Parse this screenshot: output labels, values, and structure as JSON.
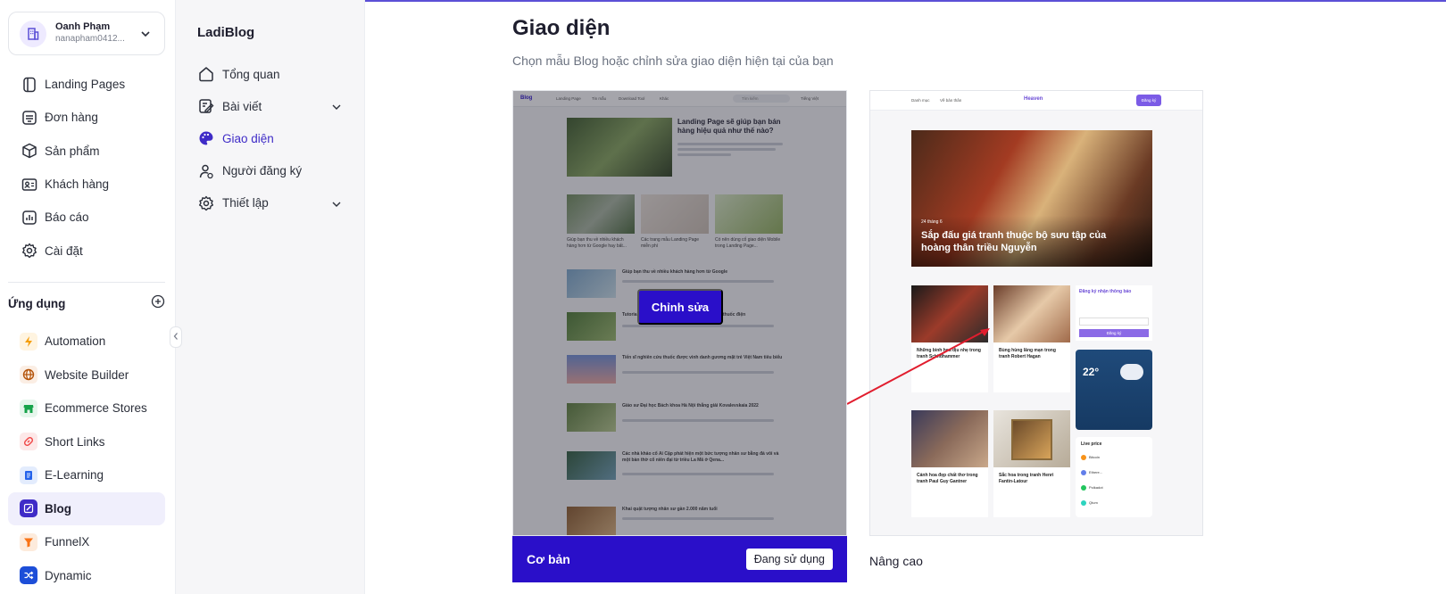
{
  "account": {
    "name": "Oanh Phạm",
    "email": "nanapham0412...",
    "avatar_icon": "building-icon"
  },
  "nav": {
    "items": [
      {
        "label": "Landing Pages",
        "icon": "pages-icon"
      },
      {
        "label": "Đơn hàng",
        "icon": "order-icon"
      },
      {
        "label": "Sản phẩm",
        "icon": "box-icon"
      },
      {
        "label": "Khách hàng",
        "icon": "contact-card-icon"
      },
      {
        "label": "Báo cáo",
        "icon": "report-icon"
      },
      {
        "label": "Cài đặt",
        "icon": "gear-icon"
      }
    ]
  },
  "apps": {
    "heading": "Ứng dụng",
    "items": [
      {
        "label": "Automation",
        "icon": "bolt-icon",
        "color": "#f59e0b"
      },
      {
        "label": "Website Builder",
        "icon": "globe-icon",
        "color": "#b45309"
      },
      {
        "label": "Ecommerce Stores",
        "icon": "store-icon",
        "color": "#16a34a"
      },
      {
        "label": "Short Links",
        "icon": "link-icon",
        "color": "#ef4444"
      },
      {
        "label": "E-Learning",
        "icon": "book-icon",
        "color": "#2563eb"
      },
      {
        "label": "Blog",
        "icon": "blog-icon",
        "color": "#3f2cc7"
      },
      {
        "label": "FunnelX",
        "icon": "funnel-icon",
        "color": "#f97316"
      },
      {
        "label": "Dynamic",
        "icon": "shuffle-icon",
        "color": "#1d4ed8"
      }
    ]
  },
  "subnav": {
    "title": "LadiBlog",
    "items": [
      {
        "label": "Tổng quan",
        "icon": "home-icon"
      },
      {
        "label": "Bài viết",
        "icon": "edit-note-icon"
      },
      {
        "label": "Giao diện",
        "icon": "palette-icon"
      },
      {
        "label": "Người đăng ký",
        "icon": "user-subscribe-icon"
      },
      {
        "label": "Thiết lập",
        "icon": "gear-icon"
      }
    ]
  },
  "main": {
    "title": "Giao diện",
    "subtitle": "Chọn mẫu Blog hoặc chỉnh sửa giao diện hiện tại của bạn",
    "themes": [
      {
        "name": "Cơ bản",
        "status": "Đang sử dụng",
        "edit_label": "Chỉnh sửa"
      },
      {
        "name": "Nâng cao"
      }
    ]
  },
  "preview_basic": {
    "nav": [
      "Blog",
      "Landing Page",
      "Tin mẫu",
      "Download Tool",
      "Khác"
    ],
    "search": "Tìm kiếm",
    "lang": "Tiếng Việt",
    "hero_title": "Landing Page sẽ giúp bạn bán hàng hiệu quả như thế nào?",
    "cards": [
      "Giúp bạn thu về nhiều khách hàng hơn từ Google hay bất...",
      "Các trang mẫu Landing Page miễn phí",
      "Có nên dùng cố giao diện Mobile trong Landing Page..."
    ],
    "posts": [
      "Giúp bạn thu về nhiều khách hàng hơn từ Google",
      "Tutorial giới hiệu cách làm được hàng tiền bán thuốc điện",
      "Tiến sĩ nghiên cứu thuốc được vinh danh gương mặt trẻ Việt Nam tiêu biểu",
      "Giáo sư Đại học Bách khoa Hà Nội thắng giải Kovalevskaia 2022",
      "Các nhà khảo cổ Ai Cập phát hiện một bức tượng nhân sư bằng đá vôi và một bàn thờ cổ niên đại từ triều La Mã ở Qena...",
      "Khai quật tượng nhân sư gần 2.000 năm tuổi"
    ]
  },
  "preview_advanced": {
    "nav": [
      "Danh mục",
      "Về bản thân"
    ],
    "brand": "Heaven",
    "cta": "Đăng ký",
    "hero_date": "24 tháng 6",
    "hero_title": "Sắp đấu giá tranh thuộc bộ sưu tập của hoàng thân triều Nguyễn",
    "subscribe_title": "Đăng ký nhận thông báo",
    "subscribe_btn": "Đăng ký",
    "weather_temp": "22°",
    "live_price": "Live price",
    "coins": [
      "Bitcoin",
      "Ethere...",
      "Polkadot",
      "Qtum"
    ],
    "posts": [
      "Những bình hoa dịu nhẹ trong tranh Schildhammer",
      "Bùng hùng lãng mạn trong tranh Robert Hagan",
      "Cảnh hoa đẹp chất thơ trong tranh Paul Guy Gantner",
      "Sắc hoa trong tranh Henri Fantin-Latour"
    ]
  }
}
